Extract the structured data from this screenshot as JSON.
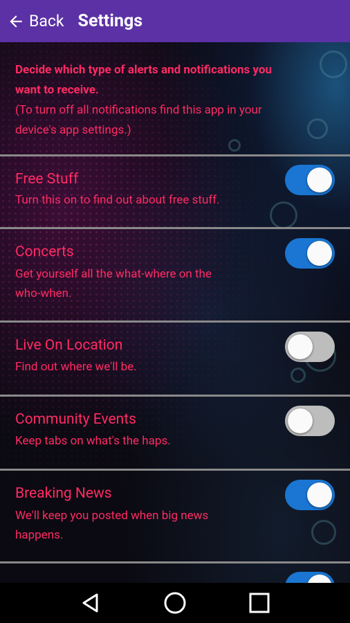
{
  "topbar": {
    "back_label": "Back",
    "title": "Settings"
  },
  "intro": {
    "line1": "Decide which type of alerts and notifications you",
    "line2": "want to receive.",
    "line3": "(To turn off all notifications find this app in your",
    "line4": "device's app settings.)"
  },
  "settings": [
    {
      "title": "Free Stuff",
      "desc": [
        "Turn this on to find out about free stuff."
      ],
      "enabled": true
    },
    {
      "title": "Concerts",
      "desc": [
        "Get yourself all the what-where on the",
        "who-when."
      ],
      "enabled": true
    },
    {
      "title": "Live On Location",
      "desc": [
        "Find out where we'll be."
      ],
      "enabled": false
    },
    {
      "title": "Community Events",
      "desc": [
        "Keep tabs on what's the haps."
      ],
      "enabled": false
    },
    {
      "title": "Breaking News",
      "desc": [
        "We'll keep you posted when big news",
        "happens."
      ],
      "enabled": true
    },
    {
      "title": "",
      "desc": [],
      "enabled": true
    }
  ],
  "colors": {
    "accent_text": "#ff2b63",
    "topbar": "#5b31a5",
    "toggle_on": "#1a76d2",
    "toggle_off": "#bdbdbd"
  },
  "icons": {
    "back": "arrow-left-icon",
    "nav_back": "triangle-back-icon",
    "nav_home": "circle-home-icon",
    "nav_recent": "square-recents-icon"
  }
}
